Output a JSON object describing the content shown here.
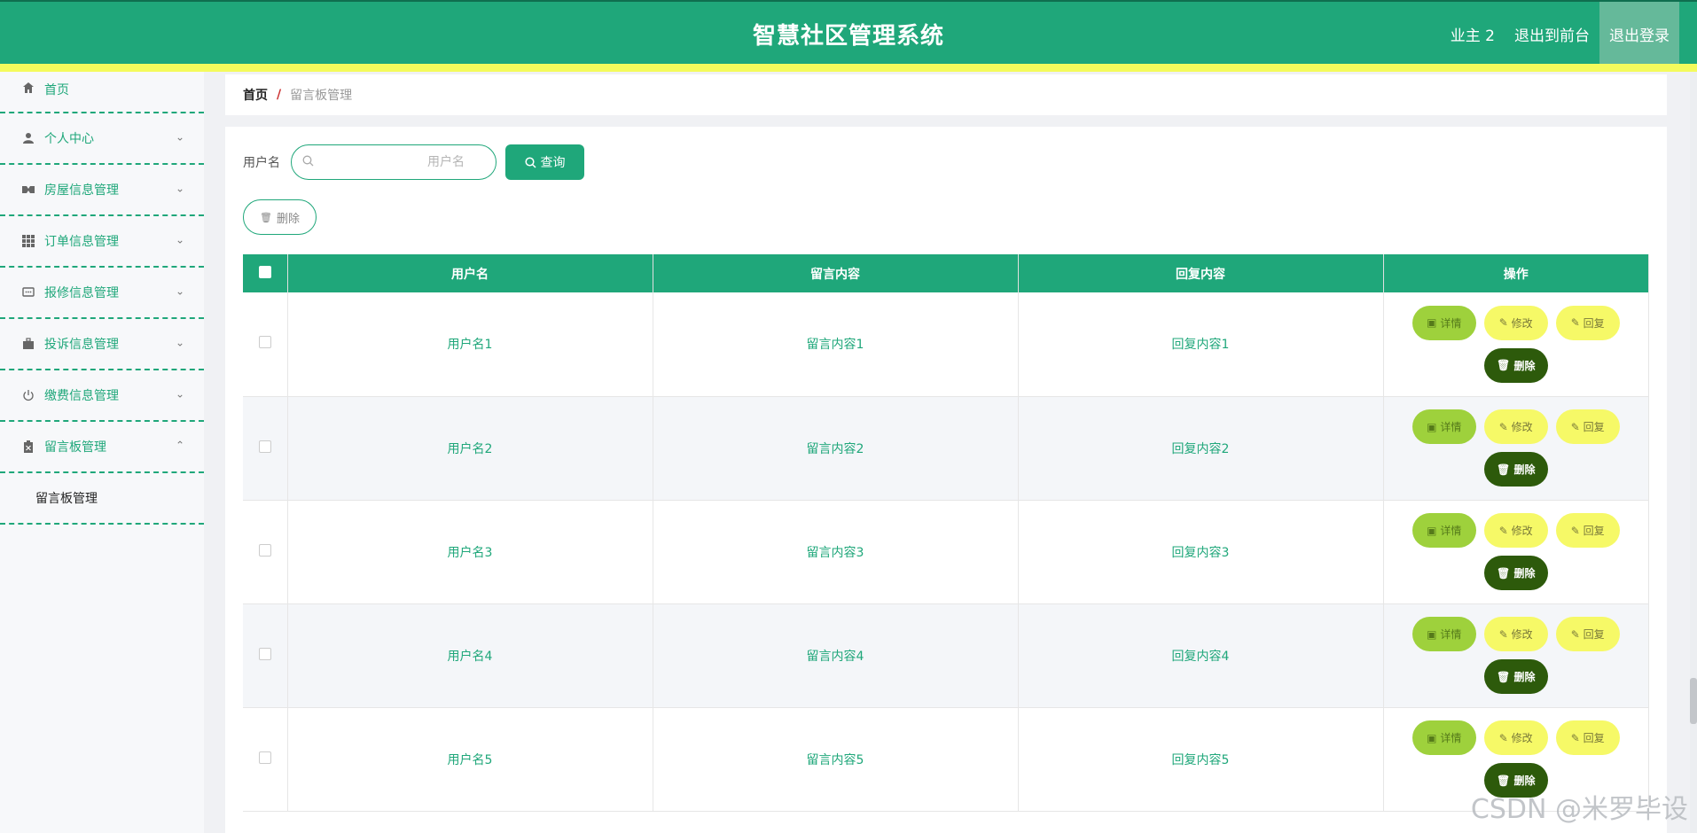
{
  "header": {
    "title": "智慧社区管理系统",
    "user": "业主 2",
    "to_front": "退出到前台",
    "logout": "退出登录"
  },
  "sidebar": {
    "items": [
      {
        "label": "首页",
        "icon": "home-icon"
      },
      {
        "label": "个人中心",
        "icon": "user-icon"
      },
      {
        "label": "房屋信息管理",
        "icon": "house-icon"
      },
      {
        "label": "订单信息管理",
        "icon": "grid-icon"
      },
      {
        "label": "报修信息管理",
        "icon": "chat-icon"
      },
      {
        "label": "投诉信息管理",
        "icon": "briefcase-icon"
      },
      {
        "label": "缴费信息管理",
        "icon": "power-icon"
      },
      {
        "label": "留言板管理",
        "icon": "clipboard-icon"
      }
    ],
    "submenu": "留言板管理"
  },
  "breadcrumb": {
    "home": "首页",
    "sep": "/",
    "current": "留言板管理"
  },
  "search": {
    "label": "用户名",
    "placeholder": "用户名",
    "button": "查询"
  },
  "actions": {
    "delete": "删除"
  },
  "table": {
    "headers": [
      "用户名",
      "留言内容",
      "回复内容",
      "操作"
    ],
    "rows": [
      {
        "user": "用户名1",
        "msg": "留言内容1",
        "reply": "回复内容1"
      },
      {
        "user": "用户名2",
        "msg": "留言内容2",
        "reply": "回复内容2"
      },
      {
        "user": "用户名3",
        "msg": "留言内容3",
        "reply": "回复内容3"
      },
      {
        "user": "用户名4",
        "msg": "留言内容4",
        "reply": "回复内容4"
      },
      {
        "user": "用户名5",
        "msg": "留言内容5",
        "reply": "回复内容5"
      }
    ],
    "ops": {
      "detail": "详情",
      "edit": "修改",
      "reply": "回复",
      "delete": "删除"
    }
  },
  "watermark": "CSDN @米罗毕设",
  "colors": {
    "primary": "#1fa77a",
    "yellow": "#f4fb5c",
    "dark_green": "#2d5a0b",
    "light_green": "#9ed13c"
  }
}
